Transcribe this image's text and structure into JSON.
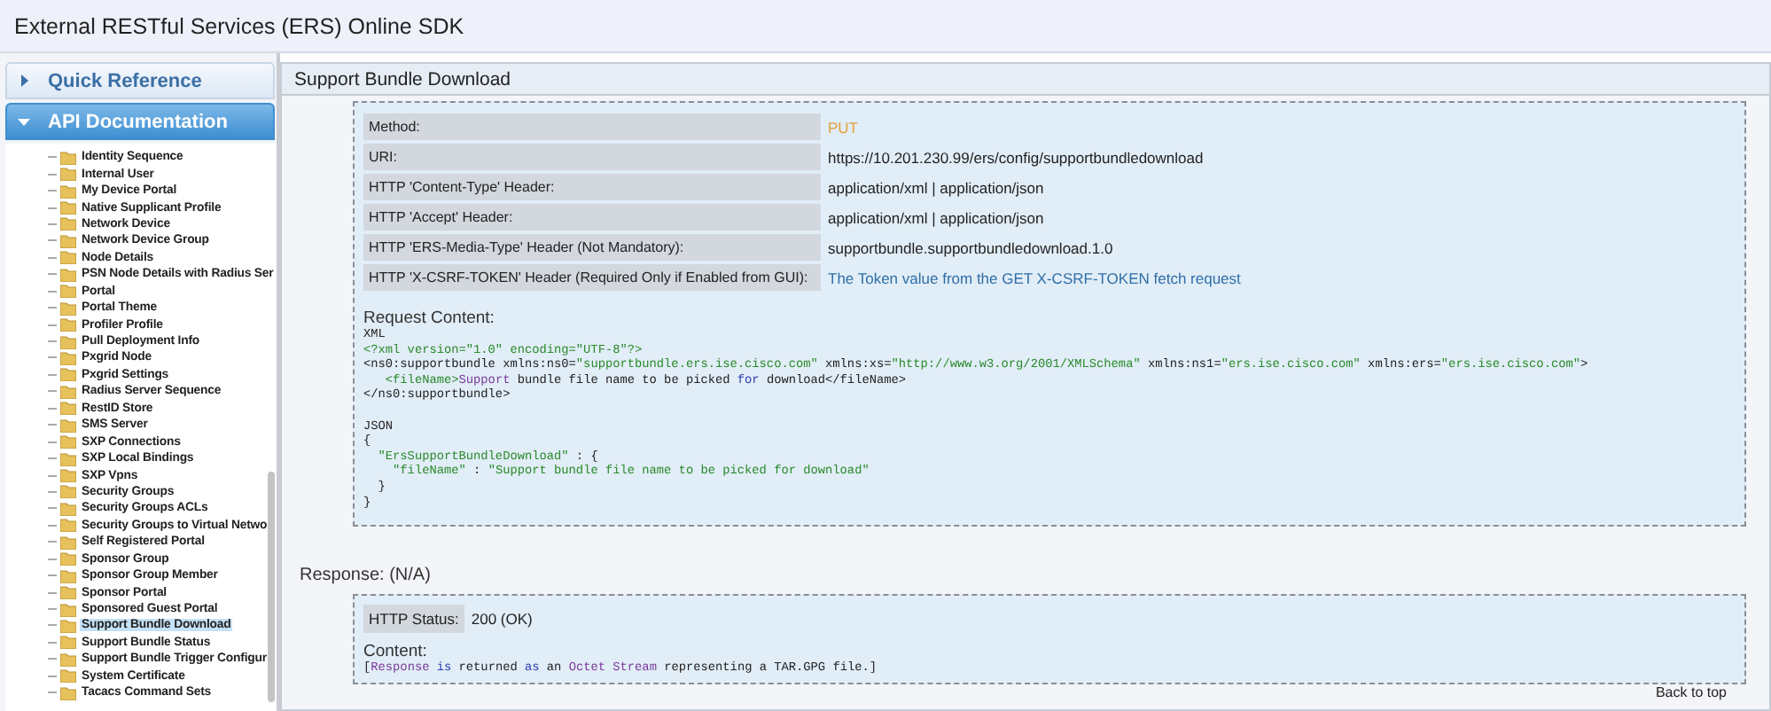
{
  "window": {
    "title": "External RESTful Services (ERS) Online SDK"
  },
  "sidebar": {
    "sections": [
      {
        "label": "Quick Reference",
        "expanded": false
      },
      {
        "label": "API Documentation",
        "expanded": true
      }
    ],
    "items": [
      {
        "label": "Identity Sequence",
        "selected": false
      },
      {
        "label": "Internal User",
        "selected": false
      },
      {
        "label": "My Device Portal",
        "selected": false
      },
      {
        "label": "Native Supplicant Profile",
        "selected": false
      },
      {
        "label": "Network Device",
        "selected": false
      },
      {
        "label": "Network Device Group",
        "selected": false
      },
      {
        "label": "Node Details",
        "selected": false
      },
      {
        "label": "PSN Node Details with Radius Ser",
        "selected": false
      },
      {
        "label": "Portal",
        "selected": false
      },
      {
        "label": "Portal Theme",
        "selected": false
      },
      {
        "label": "Profiler Profile",
        "selected": false
      },
      {
        "label": "Pull Deployment Info",
        "selected": false
      },
      {
        "label": "Pxgrid Node",
        "selected": false
      },
      {
        "label": "Pxgrid Settings",
        "selected": false
      },
      {
        "label": "Radius Server Sequence",
        "selected": false
      },
      {
        "label": "RestID Store",
        "selected": false
      },
      {
        "label": "SMS Server",
        "selected": false
      },
      {
        "label": "SXP Connections",
        "selected": false
      },
      {
        "label": "SXP Local Bindings",
        "selected": false
      },
      {
        "label": "SXP Vpns",
        "selected": false
      },
      {
        "label": "Security Groups",
        "selected": false
      },
      {
        "label": "Security Groups ACLs",
        "selected": false
      },
      {
        "label": "Security Groups to Virtual Netwo",
        "selected": false
      },
      {
        "label": "Self Registered Portal",
        "selected": false
      },
      {
        "label": "Sponsor Group",
        "selected": false
      },
      {
        "label": "Sponsor Group Member",
        "selected": false
      },
      {
        "label": "Sponsor Portal",
        "selected": false
      },
      {
        "label": "Sponsored Guest Portal",
        "selected": false
      },
      {
        "label": "Support Bundle Download",
        "selected": true
      },
      {
        "label": "Support Bundle Status",
        "selected": false
      },
      {
        "label": "Support Bundle Trigger Configur",
        "selected": false
      },
      {
        "label": "System Certificate",
        "selected": false
      },
      {
        "label": "Tacacs Command Sets",
        "selected": false
      }
    ]
  },
  "panel": {
    "title": "Support Bundle Download",
    "request": {
      "rows": [
        {
          "label": "Method:",
          "value": "PUT",
          "kind": "method"
        },
        {
          "label": "URI:",
          "value": "https://10.201.230.99/ers/config/supportbundledownload",
          "kind": "text"
        },
        {
          "label": "HTTP 'Content-Type' Header:",
          "value": "application/xml | application/json",
          "kind": "text"
        },
        {
          "label": "HTTP 'Accept' Header:",
          "value": "application/xml | application/json",
          "kind": "text"
        },
        {
          "label": "HTTP 'ERS-Media-Type' Header (Not Mandatory):",
          "value": "supportbundle.supportbundledownload.1.0",
          "kind": "text"
        },
        {
          "label": "HTTP 'X-CSRF-TOKEN' Header (Required Only if Enabled from GUI):",
          "value": "The Token value from the GET X-CSRF-TOKEN fetch request",
          "kind": "link"
        }
      ],
      "content_heading": "Request Content:",
      "code": [
        [
          {
            "text": "XML",
            "kind": "plain"
          }
        ],
        [
          {
            "text": "<?xml version=\"1.0\" encoding=\"UTF-8\"?>",
            "kind": "string"
          }
        ],
        [
          {
            "text": "<ns0:supportbundle xmlns:ns0=",
            "kind": "plain"
          },
          {
            "text": "\"supportbundle.ers.ise.cisco.com\"",
            "kind": "string"
          },
          {
            "text": " xmlns:xs=",
            "kind": "plain"
          },
          {
            "text": "\"http://www.w3.org/2001/XMLSchema\"",
            "kind": "string"
          },
          {
            "text": " xmlns:ns1=",
            "kind": "plain"
          },
          {
            "text": "\"ers.ise.cisco.com\"",
            "kind": "string"
          },
          {
            "text": " xmlns:ers=",
            "kind": "plain"
          },
          {
            "text": "\"ers.ise.cisco.com\"",
            "kind": "string"
          },
          {
            "text": ">",
            "kind": "plain"
          }
        ],
        [
          {
            "text": "   <fileName>",
            "kind": "string"
          },
          {
            "text": "Support",
            "kind": "type"
          },
          {
            "text": " bundle file name to be picked ",
            "kind": "plain"
          },
          {
            "text": "for",
            "kind": "keyword"
          },
          {
            "text": " download</fileName>",
            "kind": "plain"
          }
        ],
        [
          {
            "text": "</ns0:supportbundle>",
            "kind": "plain"
          }
        ],
        [
          {
            "text": "JSON",
            "kind": "plain",
            "gap_before": true
          }
        ],
        [
          {
            "text": "{",
            "kind": "plain"
          }
        ],
        [
          {
            "text": "  \"ErsSupportBundleDownload\"",
            "kind": "string"
          },
          {
            "text": " : {",
            "kind": "plain"
          }
        ],
        [
          {
            "text": "    \"fileName\"",
            "kind": "string"
          },
          {
            "text": " : ",
            "kind": "plain"
          },
          {
            "text": "\"Support bundle file name to be picked for download\"",
            "kind": "string"
          }
        ],
        [
          {
            "text": "  }",
            "kind": "plain"
          }
        ],
        [
          {
            "text": "}",
            "kind": "plain"
          }
        ]
      ]
    },
    "response_heading": "Response: (N/A)",
    "response": {
      "status_label": "HTTP Status:",
      "status_value": "200 (OK)",
      "content_heading": "Content:",
      "code": [
        [
          {
            "text": "[",
            "kind": "plain"
          },
          {
            "text": "Response",
            "kind": "type"
          },
          {
            "text": " is",
            "kind": "keyword"
          },
          {
            "text": " returned ",
            "kind": "plain"
          },
          {
            "text": "as",
            "kind": "keyword"
          },
          {
            "text": " an ",
            "kind": "plain"
          },
          {
            "text": "Octet Stream",
            "kind": "type"
          },
          {
            "text": " representing a TAR.GPG file.]",
            "kind": "plain"
          }
        ]
      ]
    },
    "back_link": "Back to top"
  }
}
